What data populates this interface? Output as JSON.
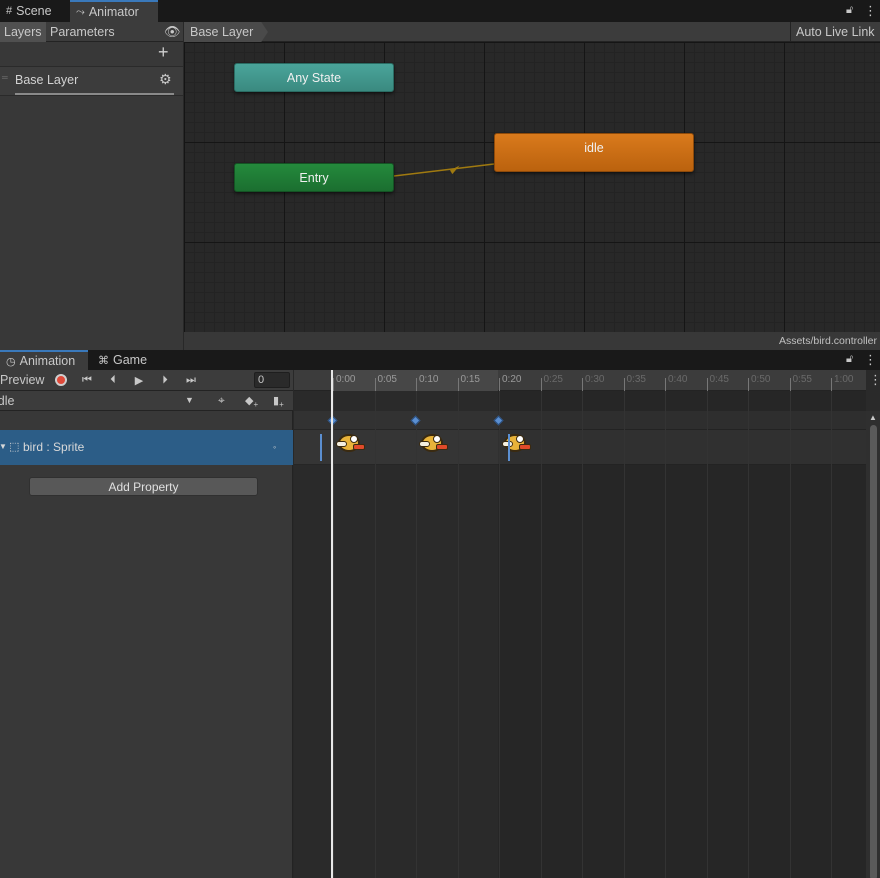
{
  "top_tabs": {
    "scene_label": "Scene",
    "animator_label": "Animator"
  },
  "animator": {
    "layers_tab": "Layers",
    "parameters_tab": "Parameters",
    "breadcrumb": "Base Layer",
    "auto_live_link": "Auto Live Link",
    "layer_name": "Base Layer",
    "asset_path": "Assets/bird.controller",
    "nodes": {
      "any_state": "Any State",
      "entry": "Entry",
      "idle": "idle"
    },
    "colors": {
      "any_state": "#3f8f86",
      "entry": "#1e7a34",
      "idle": "#c86a12",
      "transition": "#a07a10"
    }
  },
  "bottom_tabs": {
    "animation_label": "Animation",
    "game_label": "Game"
  },
  "animation": {
    "preview_label": "Preview",
    "frame_value": "0",
    "clip_name": "idle",
    "property_name": "bird : Sprite",
    "add_property_label": "Add Property",
    "timeline_ticks": [
      "0:00",
      "0:05",
      "0:10",
      "0:15",
      "0:20",
      "0:25",
      "0:30",
      "0:35",
      "0:40",
      "0:45",
      "0:50",
      "0:55",
      "1:00"
    ],
    "keyframe_ticks": [
      0,
      10,
      20
    ],
    "clip_end_tick": "0:20"
  }
}
